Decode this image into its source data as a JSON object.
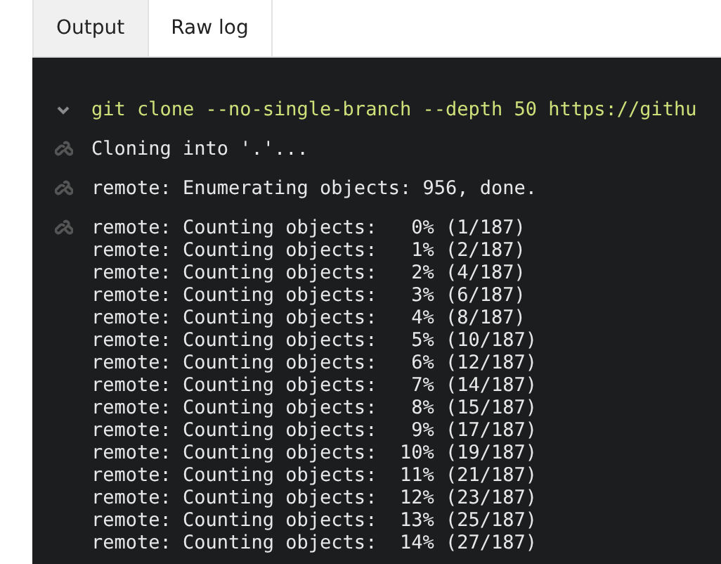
{
  "tabs": [
    {
      "label": "Output",
      "selected": true
    },
    {
      "label": "Raw log",
      "selected": false
    }
  ],
  "log": [
    {
      "kind": "command",
      "expanded": true,
      "lines": [
        "git clone --no-single-branch --depth 50 https://githu"
      ]
    },
    {
      "kind": "output",
      "lines": [
        "Cloning into '.'..."
      ]
    },
    {
      "kind": "output",
      "lines": [
        "remote: Enumerating objects: 956, done."
      ]
    },
    {
      "kind": "output",
      "lines": [
        "remote: Counting objects:   0% (1/187)",
        "remote: Counting objects:   1% (2/187)",
        "remote: Counting objects:   2% (4/187)",
        "remote: Counting objects:   3% (6/187)",
        "remote: Counting objects:   4% (8/187)",
        "remote: Counting objects:   5% (10/187)",
        "remote: Counting objects:   6% (12/187)",
        "remote: Counting objects:   7% (14/187)",
        "remote: Counting objects:   8% (15/187)",
        "remote: Counting objects:   9% (17/187)",
        "remote: Counting objects:  10% (19/187)",
        "remote: Counting objects:  11% (21/187)",
        "remote: Counting objects:  12% (23/187)",
        "remote: Counting objects:  13% (25/187)",
        "remote: Counting objects:  14% (27/187)"
      ]
    }
  ]
}
